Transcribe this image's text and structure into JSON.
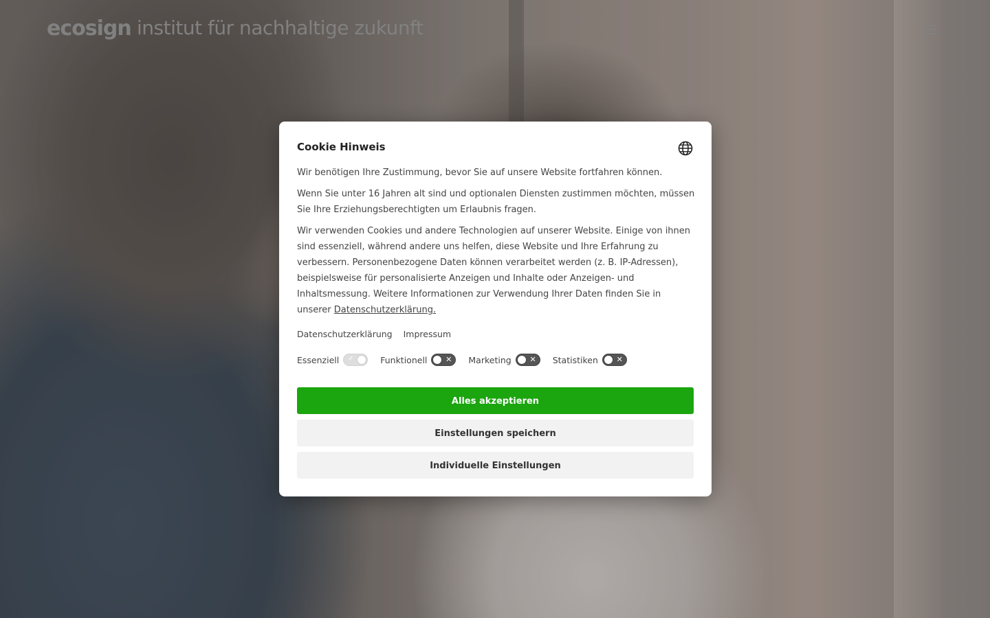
{
  "header": {
    "logo": "ecosign",
    "tagline": "institut für nachhaltige zukunft",
    "menu_icon": "hamburger-menu-icon"
  },
  "cookie_dialog": {
    "title": "Cookie Hinweis",
    "language_icon": "globe-icon",
    "paragraphs": [
      "Wir benötigen Ihre Zustimmung, bevor Sie auf unsere Website fortfahren können.",
      "Wenn Sie unter 16 Jahren alt sind und optionalen Diensten zustimmen möchten, müssen Sie Ihre Erziehungsberechtigten um Erlaubnis fragen."
    ],
    "paragraph3_prefix": "Wir verwenden Cookies und andere Technologien auf unserer Website. Einige von ihnen sind essenziell, während andere uns helfen, diese Website und Ihre Erfahrung zu verbessern. Personenbezogene Daten können verarbeitet werden (z. B. IP-Adressen), beispielsweise für personalisierte Anzeigen und Inhalte oder Anzeigen- und Inhaltsmessung. Weitere Informationen zur Verwendung Ihrer Daten finden Sie in unserer ",
    "privacy_inline_link": "Datenschutzerklärung.",
    "links": {
      "privacy": "Datenschutzerklärung",
      "imprint": "Impressum"
    },
    "toggles": [
      {
        "label": "Essenziell",
        "state": "on-disabled"
      },
      {
        "label": "Funktionell",
        "state": "off"
      },
      {
        "label": "Marketing",
        "state": "off"
      },
      {
        "label": "Statistiken",
        "state": "off"
      }
    ],
    "buttons": {
      "accept_all": "Alles akzeptieren",
      "save_settings": "Einstellungen speichern",
      "individual_settings": "Individuelle Einstellungen"
    },
    "colors": {
      "accept": "#1ba50f",
      "secondary": "#f2f2f2"
    }
  }
}
